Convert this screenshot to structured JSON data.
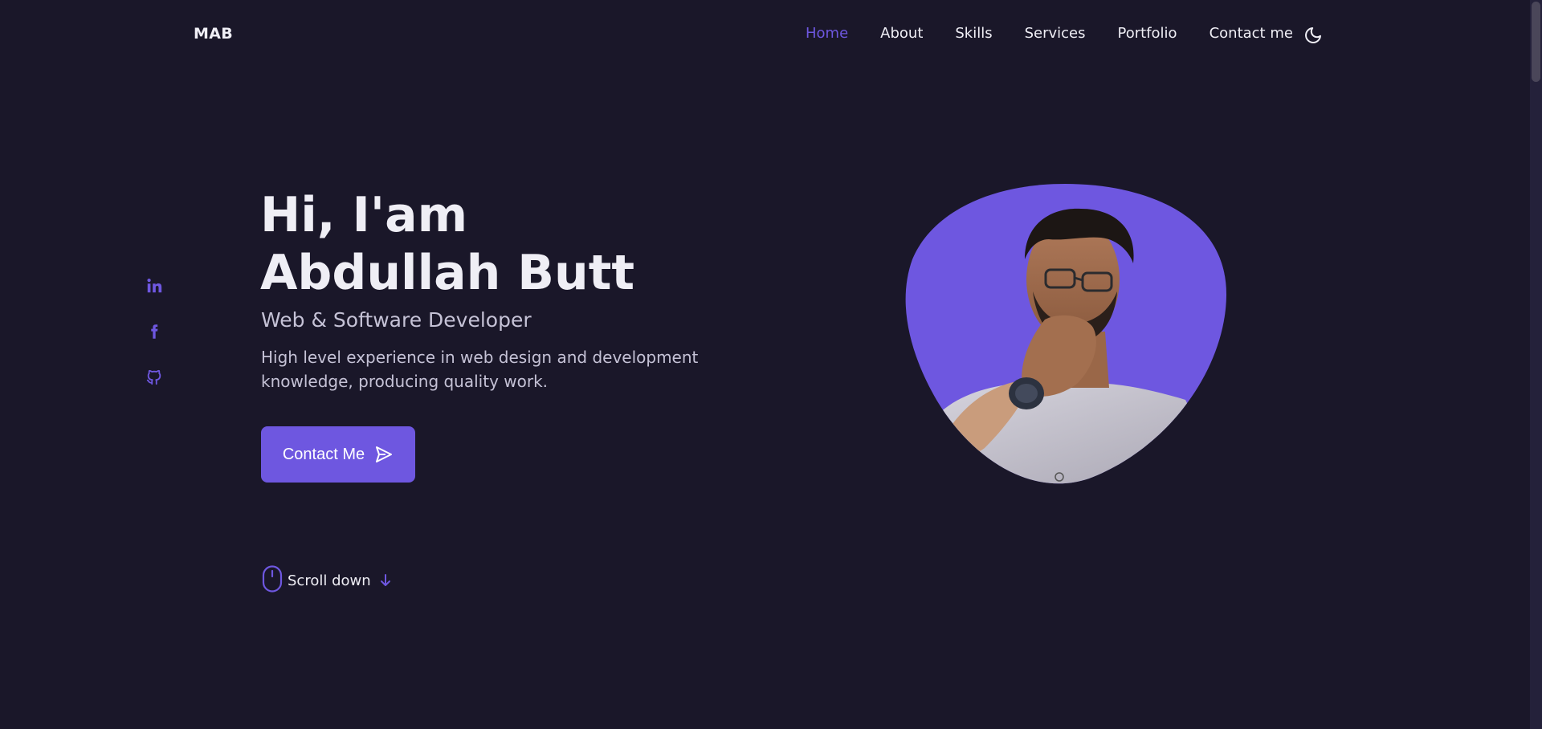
{
  "header": {
    "logo": "MAB",
    "nav": [
      {
        "label": "Home",
        "active": true
      },
      {
        "label": "About",
        "active": false
      },
      {
        "label": "Skills",
        "active": false
      },
      {
        "label": "Services",
        "active": false
      },
      {
        "label": "Portfolio",
        "active": false
      },
      {
        "label": "Contact me",
        "active": false
      }
    ],
    "theme_icon": "moon-icon"
  },
  "social": [
    {
      "name": "linkedin-icon"
    },
    {
      "name": "facebook-icon"
    },
    {
      "name": "github-icon"
    }
  ],
  "hero": {
    "title": "Hi, I'am Abdullah Butt",
    "subtitle": "Web & Software Developer",
    "description": "High level experience in web design and development knowledge, producing quality work.",
    "cta_label": "Contact Me",
    "cta_icon": "send-icon",
    "scroll_label": "Scroll down",
    "scroll_icons": [
      "mouse-icon",
      "arrow-down-icon"
    ]
  },
  "colors": {
    "background": "#1a1729",
    "accent": "#6e57e0",
    "text": "#efeef5",
    "text_muted": "#c5c2d6"
  }
}
